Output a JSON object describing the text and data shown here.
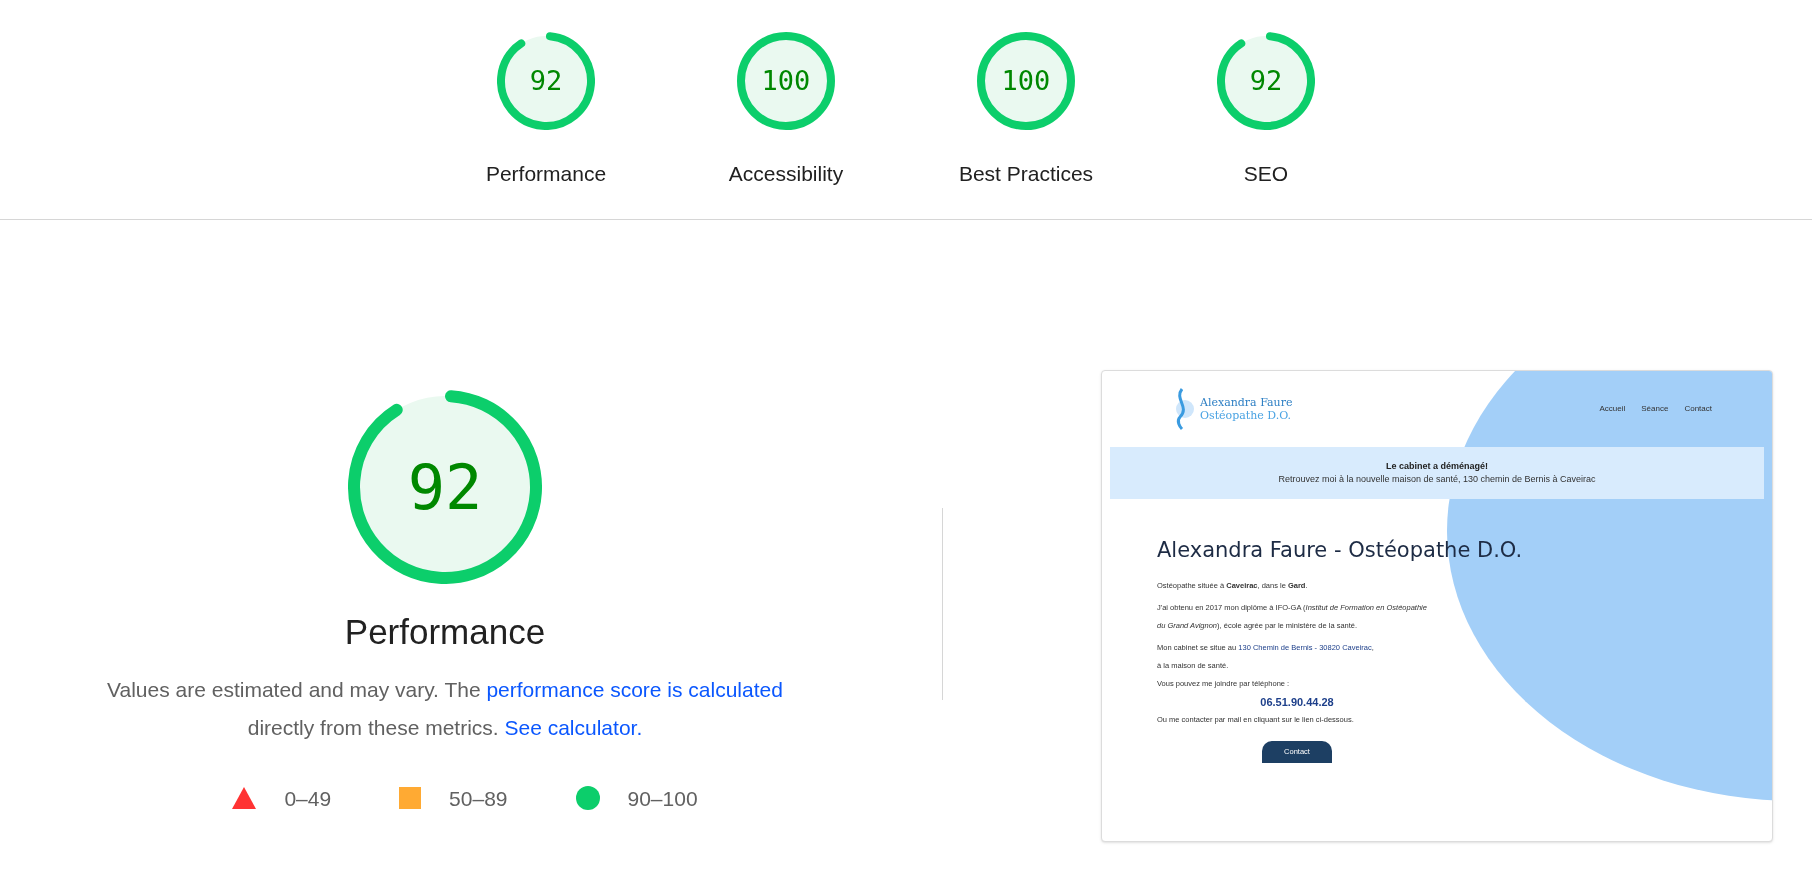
{
  "categories": [
    {
      "label": "Performance",
      "score": "92",
      "level": 0.92
    },
    {
      "label": "Accessibility",
      "score": "100",
      "level": 1
    },
    {
      "label": "Best Practices",
      "score": "100",
      "level": 1
    },
    {
      "label": "SEO",
      "score": "92",
      "level": 0.92
    }
  ],
  "main_gauge": {
    "score": "92",
    "level": 0.92,
    "title": "Performance"
  },
  "description": {
    "text_1": "Values are estimated and may vary. The",
    "link_1": "performance score is calculated",
    "text_2": "directly from these metrics.",
    "link_2": "See calculator."
  },
  "legend": [
    {
      "kind": "triangle",
      "label": "0–49"
    },
    {
      "kind": "square",
      "label": "50–89"
    },
    {
      "kind": "circle",
      "label": "90–100"
    }
  ],
  "screenshot": {
    "logo_name": "Alexandra Faure",
    "logo_subtitle": "Ostéopathe D.O.",
    "nav": [
      "Accueil",
      "Séance",
      "Contact"
    ],
    "banner_title": "Le cabinet a déménagé!",
    "banner_text": "Retrouvez moi à la nouvelle maison de santé, 130 chemin de Bernis à Caveirac",
    "heading": "Alexandra Faure - Ostéopathe D.O.",
    "paragraph_1": "Ostéopathe située à **Caveirac**, dans le **Gard**.",
    "paragraph_2": "J'ai obtenu en 2017 mon diplôme à IFO-GA (*Institut de Formation en Ostéopathie du Grand Avignon*), école agrée par le ministère de la santé.",
    "address_before": "Mon cabinet se situe au",
    "address_link": "130 Chemin de Bernis - 30820 Caveirac",
    "address_after": ",",
    "address_line_2": "à la maison de santé.",
    "phone_intro": "Vous pouvez me joindre par téléphone :",
    "phone": "06.51.90.44.28",
    "mail_text": "Ou me contacter par mail en cliquant sur le lien ci-dessous.",
    "contact_button": "Contact"
  }
}
